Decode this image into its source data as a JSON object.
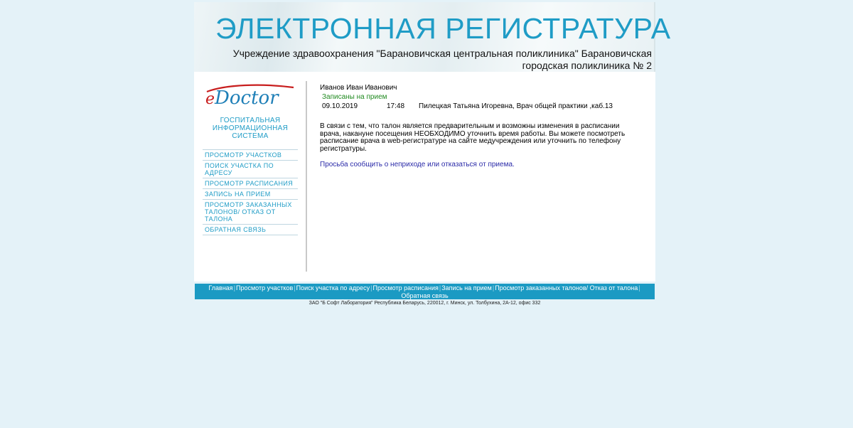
{
  "header": {
    "title": "ЭЛЕКТРОННАЯ РЕГИСТРАТУРА",
    "org_name": "Учреждение здравоохранения \"Барановичская центральная поликлиника\" Барановичская городская поликлиника № 2"
  },
  "logo": {
    "brand_e": "e",
    "brand_rest": "Doctor",
    "subtitle": "ГОСПИТАЛЬНАЯ ИНФОРМАЦИОННАЯ СИСТЕМА",
    "colors": {
      "brand": "#1e7fb7",
      "accent": "#c81e1e"
    }
  },
  "sidebar": {
    "items": [
      {
        "label": "Просмотр участков"
      },
      {
        "label": "Поиск участка по адресу"
      },
      {
        "label": "Просмотр расписания"
      },
      {
        "label": "Запись на прием"
      },
      {
        "label": "Просмотр заказанных талонов/ Отказ от талона"
      },
      {
        "label": "Обратная связь"
      }
    ]
  },
  "main": {
    "patient_name": "Иванов Иван Иванович",
    "booked_label": "Записаны на прием",
    "appointment": {
      "date": "09.10.2019",
      "time": "17:48",
      "doctor": "Пилецкая Татьяна Игоревна, Врач общей практики ,каб.13"
    },
    "notice": "В связи с тем, что талон является предварительным и возможны изменения в расписании врача, накануне посещения НЕОБХОДИМО уточнить время работы. Вы можете посмотреть расписание врача в web-регистратуре на сайте медучреждения или уточнить по телефону регистратуры.",
    "cancel_link": "Просьба сообщить о неприходе или отказаться от приема."
  },
  "footer": {
    "nav": [
      {
        "label": "Главная"
      },
      {
        "label": "Просмотр участков"
      },
      {
        "label": "Поиск участка по адресу"
      },
      {
        "label": "Просмотр расписания"
      },
      {
        "label": "Запись на прием"
      },
      {
        "label": "Просмотр заказанных талонов/ Отказ от талона"
      },
      {
        "label": "Обратная связь"
      }
    ],
    "separator": "|",
    "copyright": "ЗАО \"Б Софт Лаборатория\" Республика Беларусь, 220012, г. Минск, ул. Толбухина, 2А-12, офис 332"
  },
  "colors": {
    "page_bg": "#e4f2f8",
    "accent": "#1f9cc6",
    "footer_bar": "#1b9ac3",
    "booked_green": "#228b22",
    "link_blue": "#2a2aa8"
  }
}
